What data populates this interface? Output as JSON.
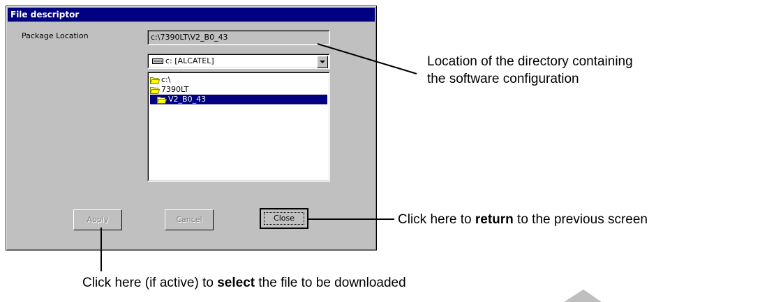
{
  "dialog": {
    "title": "File descriptor",
    "package_location_label": "Package Location",
    "package_location_value": "c:\\7390LT\\V2_B0_43",
    "drive_combo": {
      "value": "c: [ALCATEL]"
    },
    "folders": [
      "c:\\",
      "7390LT",
      "V2_B0_43"
    ],
    "selected_folder": "V2_B0_43",
    "buttons": {
      "apply": "Apply",
      "cancel": "Cancel",
      "close": "Close"
    }
  },
  "annotations": {
    "location_line1": "Location of the directory containing",
    "location_line2": "the software configuration",
    "close_prefix": "Click here to ",
    "close_bold": "return",
    "close_suffix": " to the previous screen",
    "apply_prefix": "Click here (if active) to ",
    "apply_bold": "select",
    "apply_suffix": " the file to be downloaded"
  }
}
